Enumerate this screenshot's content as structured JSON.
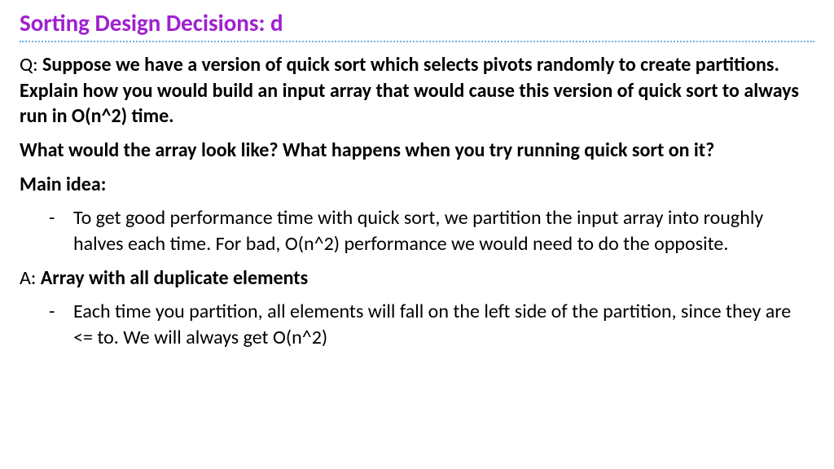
{
  "title": "Sorting Design Decisions: d",
  "q_prefix": "Q: ",
  "question": "Suppose we have a version of quick sort which selects pivots randomly to create partitions. Explain how you would build an input array that would cause this version of quick sort to always run in O(n^2) time.",
  "followup": "What would the array look like? What happens when you try running quick sort on it?",
  "main_idea_label": "Main idea:",
  "main_idea_bullets": [
    "To get good performance time with quick sort, we partition the input array into roughly halves each time. For bad, O(n^2) performance we would need to do the opposite."
  ],
  "a_prefix": "A: ",
  "answer_heading": "Array with all duplicate elements",
  "answer_bullets": [
    "Each time you partition, all elements will fall on the left side of the partition, since they are <= to. We will always get O(n^2)"
  ]
}
